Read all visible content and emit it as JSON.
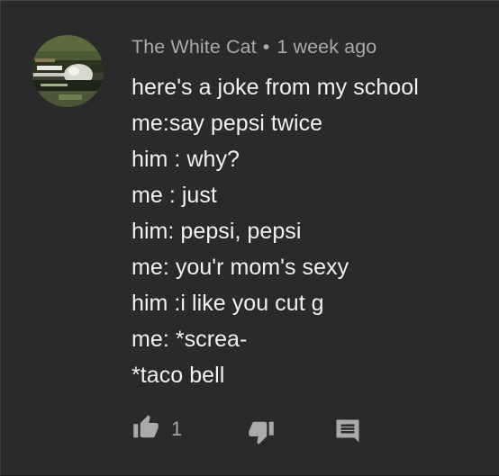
{
  "comment": {
    "author": "The White Cat",
    "separator": "•",
    "timestamp": "1 week ago",
    "lines": [
      "here's a joke from my school",
      "me:say pepsi twice",
      "him : why?",
      "me : just",
      "him: pepsi, pepsi",
      "me: you'r mom's sexy",
      "him :i like you cut g",
      "me: *screa-",
      "*taco bell"
    ],
    "like_count": "1"
  },
  "icons": {
    "like": "thumbs-up-icon",
    "dislike": "thumbs-down-icon",
    "reply": "comment-icon"
  },
  "colors": {
    "background": "#282828",
    "text_primary": "#f1f1f1",
    "text_secondary": "#aaaaaa",
    "icon": "#aaaaaa"
  }
}
